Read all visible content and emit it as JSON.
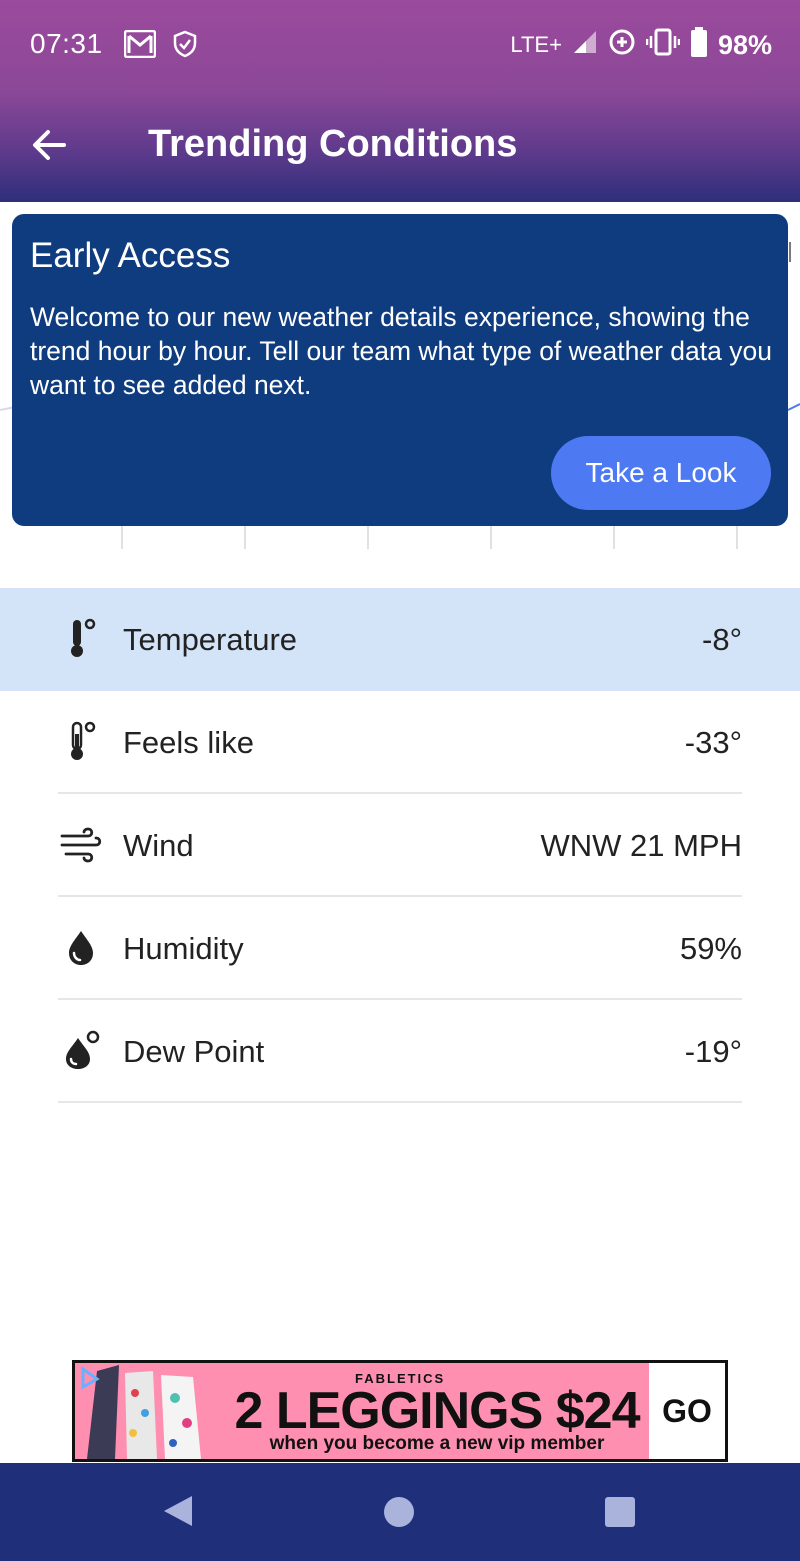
{
  "status_bar": {
    "time": "07:31",
    "network": "LTE+",
    "battery": "98%",
    "icons": [
      "gmail-icon",
      "shield-icon",
      "signal-icon",
      "data-saver-icon",
      "vibrate-icon",
      "battery-icon"
    ]
  },
  "app_bar": {
    "title": "Trending Conditions",
    "back_icon": "arrow-left-icon"
  },
  "early_access": {
    "title": "Early Access",
    "body": "Welcome to our new weather details experience, showing the trend hour by hour. Tell our team what type of weather data you want to see added next.",
    "button_label": "Take a Look"
  },
  "conditions": [
    {
      "label": "Temperature",
      "value": "-8°",
      "icon": "thermometer-icon",
      "selected": true
    },
    {
      "label": "Feels like",
      "value": "-33°",
      "icon": "feels-like-thermometer-icon",
      "selected": false
    },
    {
      "label": "Wind",
      "value": "WNW 21 MPH",
      "icon": "wind-icon",
      "selected": false
    },
    {
      "label": "Humidity",
      "value": "59%",
      "icon": "humidity-drop-icon",
      "selected": false
    },
    {
      "label": "Dew Point",
      "value": "-19°",
      "icon": "dew-point-icon",
      "selected": false
    }
  ],
  "ad": {
    "brand": "FABLETICS",
    "headline": "2 LEGGINGS $24",
    "subline": "when you become a new vip member",
    "cta": "GO"
  },
  "colors": {
    "header_top": "#9b4a9c",
    "header_bottom": "#2f2f7a",
    "card_bg": "#0f3c7e",
    "button_bg": "#4d79f2",
    "selected_row": "#d3e4f8",
    "nav_bar": "#1f2f7a"
  }
}
